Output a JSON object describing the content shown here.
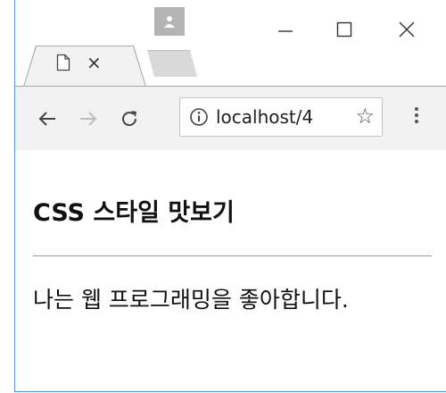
{
  "browser": {
    "tab": {
      "close_label": "×"
    },
    "window_controls": {
      "minimize": "—",
      "close": "✕"
    },
    "address_bar": {
      "url": "localhost/4"
    }
  },
  "page": {
    "heading": "CSS 스타일 맛보기",
    "paragraph": "나는 웹 프로그래밍을 좋아합니다."
  },
  "colors": {
    "window_border": "#5b8fd6",
    "toolbar_bg": "#f2f2f2",
    "profile_bg": "#b4b4b4"
  }
}
